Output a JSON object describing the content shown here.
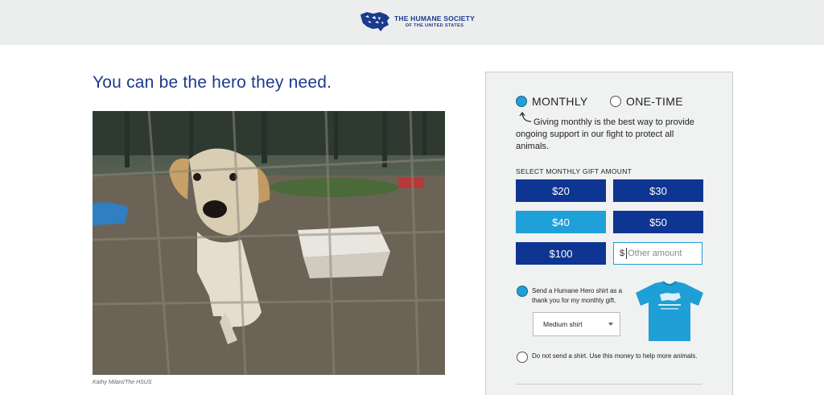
{
  "header": {
    "logo_line1": "THE HUMANE SOCIETY",
    "logo_line2": "OF THE UNITED STATES",
    "logo_icon": "usa-map-animals-logo"
  },
  "main": {
    "headline": "You can be the hero they need.",
    "photo_alt": "dog-behind-fence-photo",
    "photo_credit": "Kathy Milani/The HSUS"
  },
  "donation": {
    "frequency": {
      "monthly_label": "MONTHLY",
      "onetime_label": "ONE-TIME",
      "selected": "monthly"
    },
    "note": "Giving monthly is the best way to provide ongoing support in our fight to protect all animals.",
    "amount_title": "SELECT MONTHLY GIFT AMOUNT",
    "amounts": [
      "$20",
      "$30",
      "$40",
      "$50",
      "$100"
    ],
    "selected_amount": "$40",
    "other": {
      "currency": "$",
      "placeholder": "Other amount"
    },
    "shirt_option": {
      "label": "Send a Humane Hero shirt as a thank you for my monthly gift.",
      "selected": true,
      "size_value": "Medium shirt"
    },
    "no_shirt_option": {
      "label": "Do not send a shirt. Use this money to help more animals.",
      "selected": false
    },
    "colors": {
      "navy": "#0f3592",
      "accent": "#1fa0d8"
    }
  }
}
